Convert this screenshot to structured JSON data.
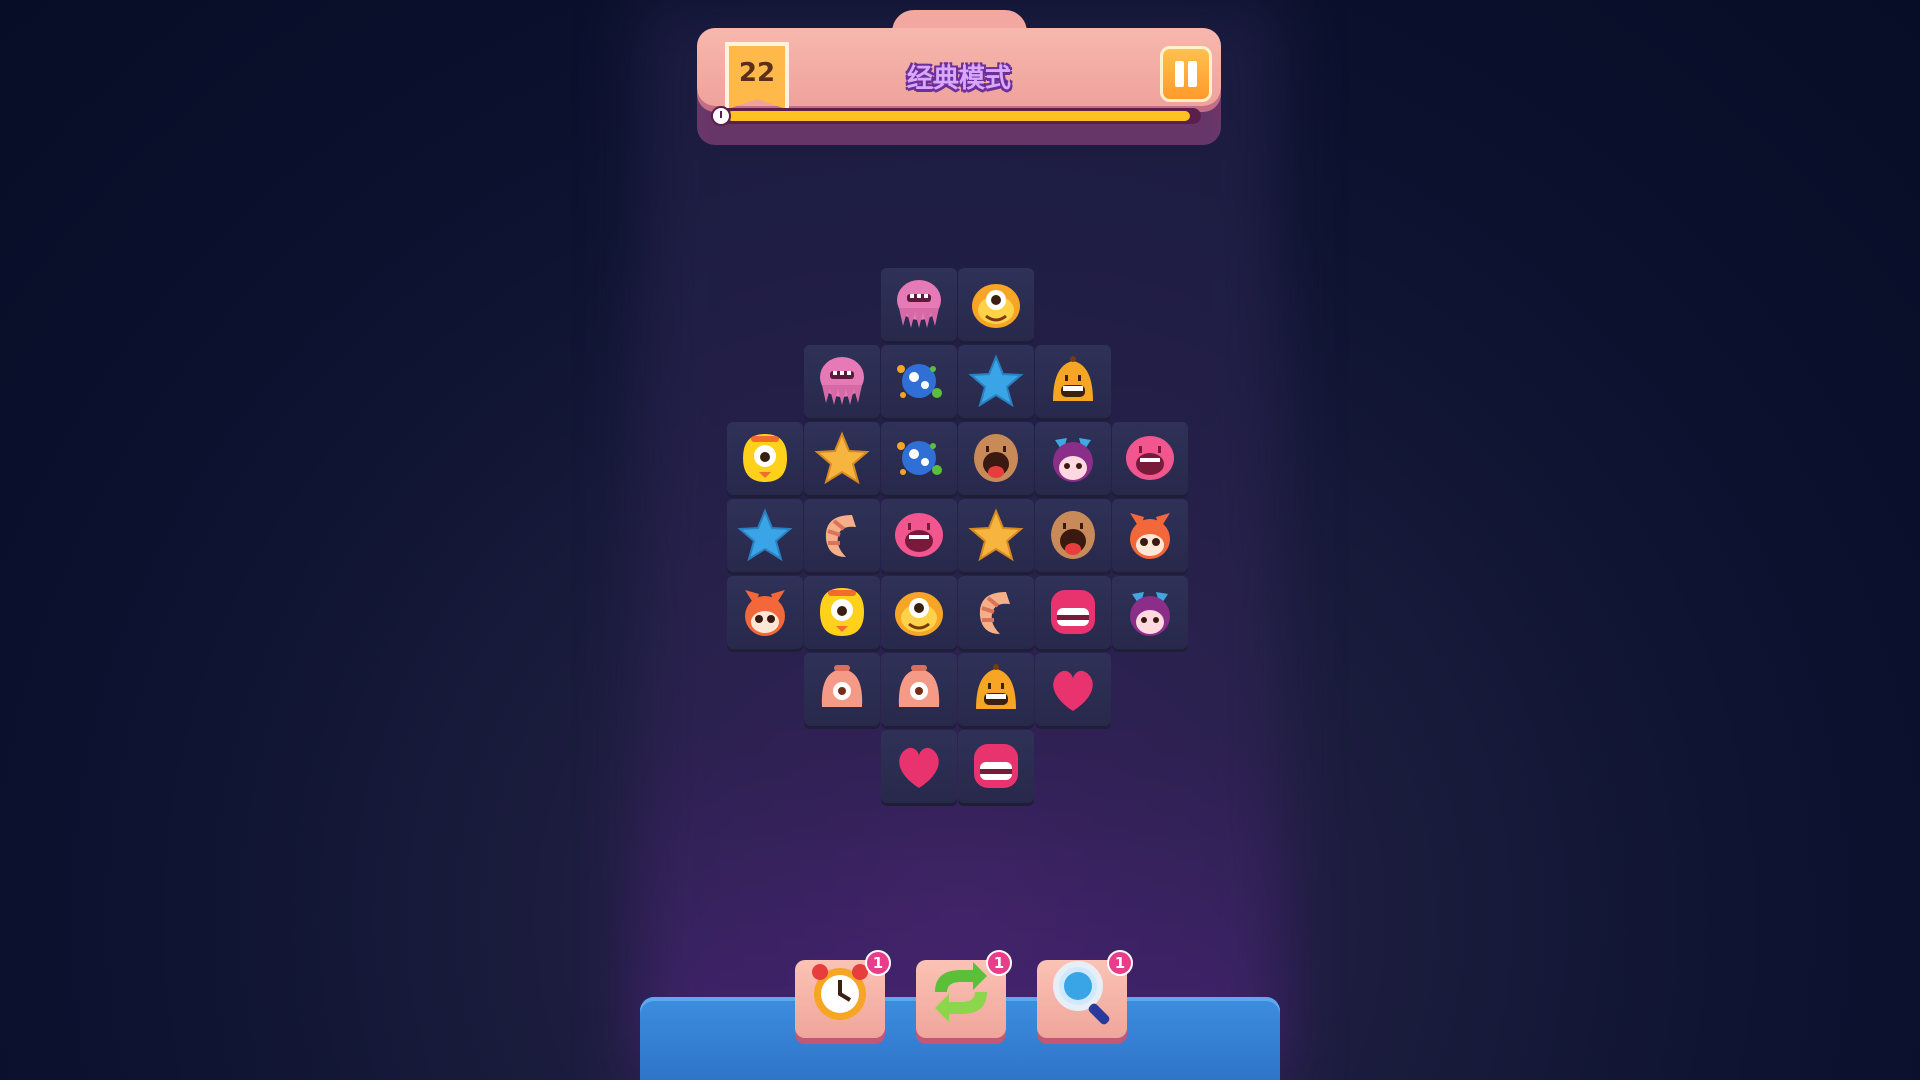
{
  "header": {
    "level_number": "22",
    "mode_title": "经典模式",
    "timer_progress": 0.98
  },
  "board": {
    "tiles": [
      {
        "row": 0,
        "col": 2,
        "icon": "pink-jellyfish-icon"
      },
      {
        "row": 0,
        "col": 3,
        "icon": "orange-cyclops-icon"
      },
      {
        "row": 1,
        "col": 1,
        "icon": "pink-jellyfish-icon"
      },
      {
        "row": 1,
        "col": 2,
        "icon": "blue-bubbles-icon"
      },
      {
        "row": 1,
        "col": 3,
        "icon": "blue-star-icon"
      },
      {
        "row": 1,
        "col": 4,
        "icon": "orange-bell-icon"
      },
      {
        "row": 2,
        "col": 0,
        "icon": "yellow-cyclops-icon"
      },
      {
        "row": 2,
        "col": 1,
        "icon": "orange-star-icon"
      },
      {
        "row": 2,
        "col": 2,
        "icon": "blue-bubbles-icon"
      },
      {
        "row": 2,
        "col": 3,
        "icon": "brown-tongue-icon"
      },
      {
        "row": 2,
        "col": 4,
        "icon": "purple-cat-girl-icon"
      },
      {
        "row": 2,
        "col": 5,
        "icon": "pink-shout-icon"
      },
      {
        "row": 3,
        "col": 0,
        "icon": "blue-star-icon"
      },
      {
        "row": 3,
        "col": 1,
        "icon": "shrimp-icon"
      },
      {
        "row": 3,
        "col": 2,
        "icon": "pink-shout-icon"
      },
      {
        "row": 3,
        "col": 3,
        "icon": "orange-star-icon"
      },
      {
        "row": 3,
        "col": 4,
        "icon": "brown-tongue-icon"
      },
      {
        "row": 3,
        "col": 5,
        "icon": "orange-fox-icon"
      },
      {
        "row": 4,
        "col": 0,
        "icon": "orange-fox-icon"
      },
      {
        "row": 4,
        "col": 1,
        "icon": "yellow-cyclops-icon"
      },
      {
        "row": 4,
        "col": 2,
        "icon": "orange-cyclops-icon"
      },
      {
        "row": 4,
        "col": 3,
        "icon": "shrimp-icon"
      },
      {
        "row": 4,
        "col": 4,
        "icon": "pink-teeth-icon"
      },
      {
        "row": 4,
        "col": 5,
        "icon": "purple-cat-girl-icon"
      },
      {
        "row": 5,
        "col": 1,
        "icon": "peach-cyclops-icon"
      },
      {
        "row": 5,
        "col": 2,
        "icon": "peach-cyclops-icon"
      },
      {
        "row": 5,
        "col": 3,
        "icon": "orange-bell-icon"
      },
      {
        "row": 5,
        "col": 4,
        "icon": "pink-heart-icon"
      },
      {
        "row": 6,
        "col": 2,
        "icon": "pink-heart-icon"
      },
      {
        "row": 6,
        "col": 3,
        "icon": "pink-teeth-icon"
      }
    ]
  },
  "boosters": [
    {
      "name": "alarm-clock-icon",
      "count": "1"
    },
    {
      "name": "shuffle-icon",
      "count": "1"
    },
    {
      "name": "magnifier-icon",
      "count": "1"
    }
  ],
  "colors": {
    "header_bg": "#f7b7ad",
    "progress_fill": "#ffc21e",
    "bottom_bar": "#3d8ee0",
    "badge": "#e83d8a",
    "tile_bg": "#2f3158"
  }
}
